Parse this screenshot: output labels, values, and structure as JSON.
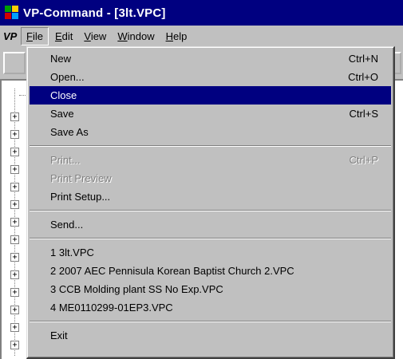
{
  "window": {
    "title": "VP-Command - [3lt.VPC]"
  },
  "menubar": {
    "logo": "VP",
    "items": [
      {
        "label": "File",
        "mnemonic": "F"
      },
      {
        "label": "Edit",
        "mnemonic": "E"
      },
      {
        "label": "View",
        "mnemonic": "V"
      },
      {
        "label": "Window",
        "mnemonic": "W"
      },
      {
        "label": "Help",
        "mnemonic": "H"
      }
    ]
  },
  "file_menu": {
    "items": [
      {
        "label": "New",
        "shortcut": "Ctrl+N",
        "state": "normal"
      },
      {
        "label": "Open...",
        "shortcut": "Ctrl+O",
        "state": "normal"
      },
      {
        "label": "Close",
        "shortcut": "",
        "state": "highlighted"
      },
      {
        "label": "Save",
        "shortcut": "Ctrl+S",
        "state": "normal"
      },
      {
        "label": "Save As",
        "shortcut": "",
        "state": "normal"
      },
      {
        "label": "Print...",
        "shortcut": "Ctrl+P",
        "state": "disabled"
      },
      {
        "label": "Print Preview",
        "shortcut": "",
        "state": "disabled"
      },
      {
        "label": "Print Setup...",
        "shortcut": "",
        "state": "normal"
      },
      {
        "label": "Send...",
        "shortcut": "",
        "state": "normal"
      },
      {
        "label": "1 3lt.VPC",
        "shortcut": "",
        "state": "normal"
      },
      {
        "label": "2 2007 AEC Pennisula Korean Baptist Church 2.VPC",
        "shortcut": "",
        "state": "normal"
      },
      {
        "label": "3 CCB Molding plant SS No Exp.VPC",
        "shortcut": "",
        "state": "normal"
      },
      {
        "label": "4 ME0110299-01EP3.VPC",
        "shortcut": "",
        "state": "normal"
      },
      {
        "label": "Exit",
        "shortcut": "",
        "state": "normal"
      }
    ]
  },
  "colors": {
    "titlebar": "#000080",
    "chrome": "#c0c0c0",
    "highlight": "#000080",
    "disabled_text": "#808080"
  },
  "icons": {
    "app": "vp-command-app-icon",
    "tree_expander": "plus-box-icon"
  }
}
